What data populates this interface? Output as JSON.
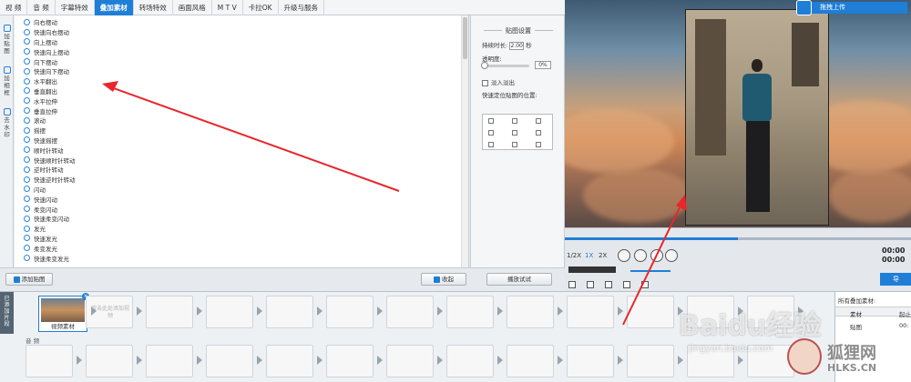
{
  "top_tabs": [
    "视 频",
    "音 频",
    "字幕特效",
    "叠加素材",
    "转场特效",
    "画面风格",
    "M T V",
    "卡拉OK",
    "升级与服务"
  ],
  "active_tab_index": 3,
  "side_tabs": [
    "加贴图",
    "加相框",
    "去水印"
  ],
  "effects": [
    "向右摆动",
    "快速向右摆动",
    "向上摆动",
    "快速向上摆动",
    "向下摆动",
    "快速向下摆动",
    "水平翻出",
    "垂直翻出",
    "水平拉伸",
    "垂直拉伸",
    "滚动",
    "摇摆",
    "快速摇摆",
    "顺时针转动",
    "快速顺时针转动",
    "逆时针转动",
    "快速逆时针转动",
    "闪动",
    "快速闪动",
    "柔变闪动",
    "快速柔变闪动",
    "发光",
    "快速发光",
    "柔变发光",
    "快速柔变发光"
  ],
  "settings": {
    "title": "贴图设置",
    "duration_label": "持续时长:",
    "duration_value": "2.00",
    "duration_unit": "秒",
    "opacity_label": "透明度:",
    "opacity_value": "0%",
    "fade_label": "淡入淡出",
    "position_label": "快速定位贴图的位置:"
  },
  "buttons": {
    "add_sticker": "添加贴图",
    "collapse": "收起",
    "preview_play": "播放试试",
    "upload": "拖拽上传",
    "export": "导"
  },
  "player": {
    "speeds": [
      "1/2X",
      "1X",
      "2X"
    ],
    "active_speed_index": 1,
    "progress": 0.5,
    "time_top": "00:00",
    "time_bottom": "00:00"
  },
  "timeline": {
    "added_label": "已添加片段",
    "first_clip": "视频素材",
    "add_slot_text": "双击此处添加视频",
    "audio_label": "音 频"
  },
  "materials": {
    "title": "所有叠加素材:",
    "col1": "素材",
    "col2": "起止",
    "row_name": "贴图",
    "row_time": "00:"
  },
  "watermarks": {
    "baidu": "Baidu经验",
    "jingyan": "jingyan.baidu.com",
    "site": "狐狸网",
    "site_url": "HLKS.CN"
  },
  "colors": {
    "accent": "#1f7ed6",
    "annotation": "#e8262b"
  }
}
